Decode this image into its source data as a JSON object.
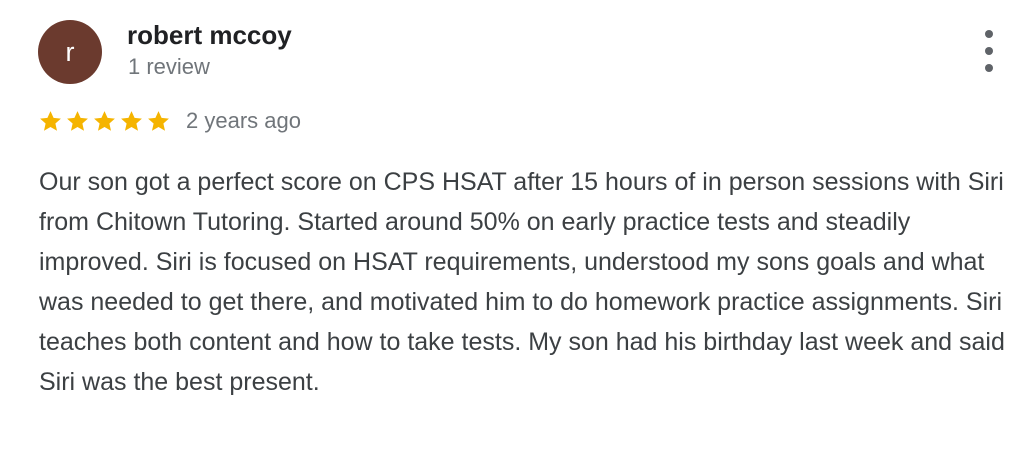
{
  "review": {
    "author": {
      "initial": "r",
      "name": "robert mccoy",
      "meta": "1 review",
      "avatar_color": "#6b3a2e"
    },
    "rating": {
      "stars": 5,
      "max": 5,
      "star_color": "#f5b400",
      "time_ago": "2 years ago"
    },
    "more_icon": "more-vertical-icon",
    "text": "Our son got a perfect score on CPS HSAT after 15 hours of in person sessions with Siri from Chitown Tutoring. Started around 50% on early practice tests and steadily improved. Siri is focused on HSAT requirements, understood my sons goals and what was needed to get there, and motivated him to do homework practice assignments. Siri teaches both content and how to take tests. My son had his birthday last week and said Siri was the best present."
  }
}
